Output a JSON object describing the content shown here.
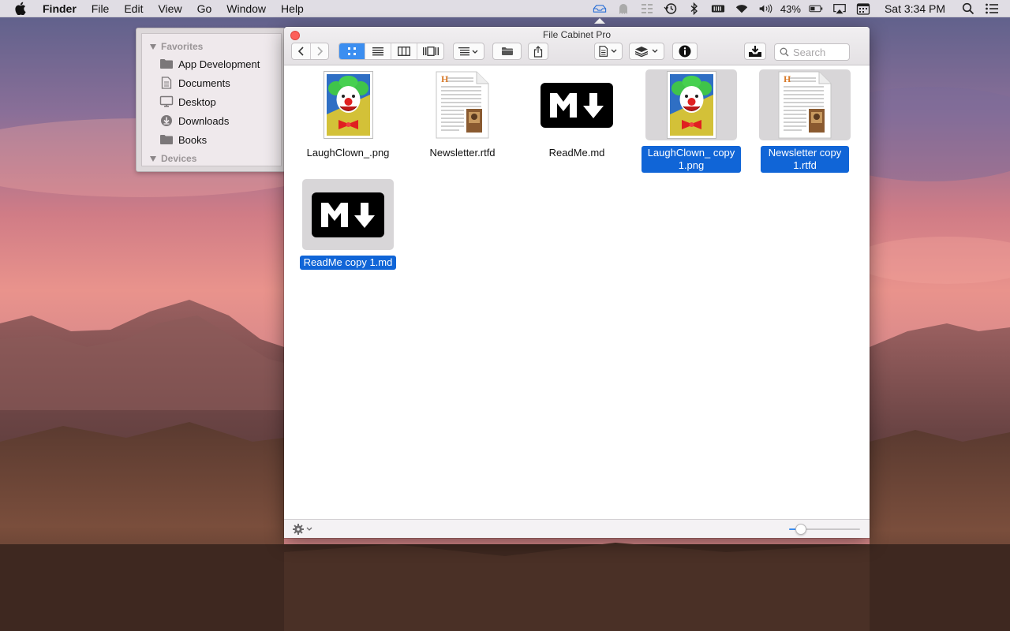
{
  "menubar": {
    "app_name": "Finder",
    "menus": [
      "File",
      "Edit",
      "View",
      "Go",
      "Window",
      "Help"
    ],
    "battery_text": "43%",
    "clock": "Sat 3:34 PM",
    "status_icons": [
      "file-cabinet-icon",
      "ghost-icon",
      "list-icon",
      "time-machine-icon",
      "bluetooth-icon",
      "memory-icon",
      "wifi-icon",
      "volume-icon",
      "battery-icon",
      "airplay-icon",
      "calendar-icon",
      "spotlight-icon",
      "notification-center-icon"
    ]
  },
  "sidebar": {
    "sections": [
      {
        "title": "Favorites",
        "items": [
          {
            "label": "App Development",
            "icon": "folder-icon"
          },
          {
            "label": "Documents",
            "icon": "document-icon"
          },
          {
            "label": "Desktop",
            "icon": "desktop-icon"
          },
          {
            "label": "Downloads",
            "icon": "downloads-icon"
          },
          {
            "label": "Books",
            "icon": "folder-icon"
          }
        ]
      },
      {
        "title": "Devices",
        "items": []
      }
    ]
  },
  "window": {
    "title": "File Cabinet Pro",
    "search_placeholder": "Search",
    "view_mode": "icon",
    "files": [
      {
        "name": "LaughClown_.png",
        "kind": "image",
        "selected": false
      },
      {
        "name": "Newsletter.rtfd",
        "kind": "rtfd",
        "selected": false
      },
      {
        "name": "ReadMe.md",
        "kind": "markdown",
        "selected": false
      },
      {
        "name": "LaughClown_ copy 1.png",
        "kind": "image",
        "selected": true
      },
      {
        "name": "Newsletter copy 1.rtfd",
        "kind": "rtfd",
        "selected": true
      },
      {
        "name": "ReadMe copy 1.md",
        "kind": "markdown",
        "selected": true
      }
    ],
    "icon_size_fraction": 0.17
  },
  "colors": {
    "accent": "#3b8ef0",
    "selection": "#1065d7",
    "close": "#fc605b"
  }
}
